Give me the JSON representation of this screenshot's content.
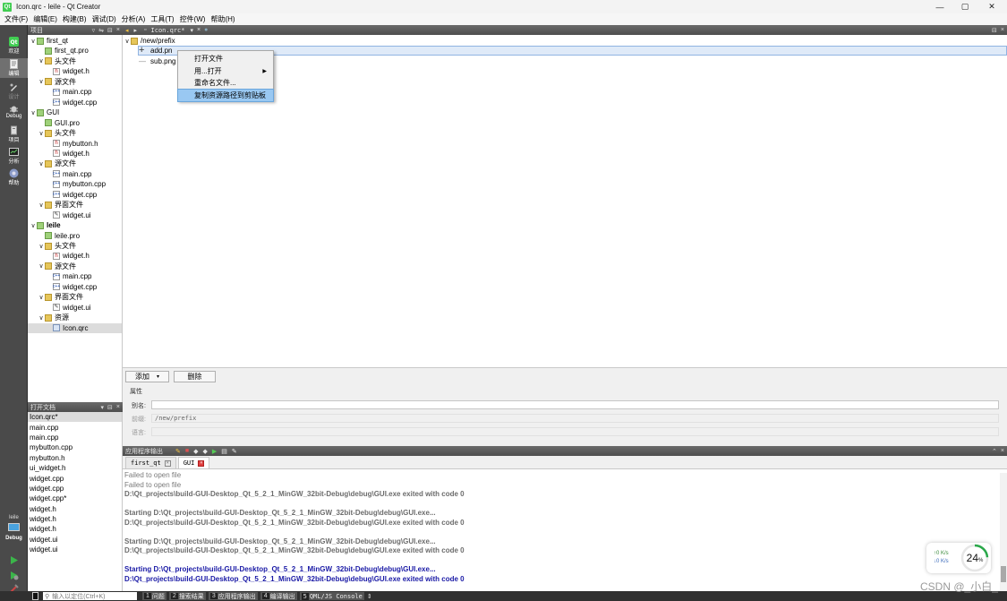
{
  "window": {
    "title": "Icon.qrc - leile - Qt Creator",
    "app_icon_text": "Qt",
    "minimize": "—",
    "maximize": "▢",
    "close": "✕"
  },
  "menubar": [
    "文件(F)",
    "编辑(E)",
    "构建(B)",
    "调试(D)",
    "分析(A)",
    "工具(T)",
    "控件(W)",
    "帮助(H)"
  ],
  "modes": [
    {
      "label": "欢迎",
      "icon": "welcome-icon"
    },
    {
      "label": "编辑",
      "icon": "edit-icon",
      "active": true
    },
    {
      "label": "设计",
      "icon": "design-icon"
    },
    {
      "label": "Debug",
      "icon": "debug-icon"
    },
    {
      "label": "项目",
      "icon": "projects-icon"
    },
    {
      "label": "分析",
      "icon": "analyze-icon"
    },
    {
      "label": "帮助",
      "icon": "help-icon"
    }
  ],
  "kit": {
    "project": "leile",
    "mode": "Debug"
  },
  "project_pane": {
    "title": "项目"
  },
  "project_tree": [
    {
      "indent": 0,
      "arrow": "∨",
      "icon": "pro",
      "label": "first_qt"
    },
    {
      "indent": 1,
      "arrow": "",
      "icon": "pro-file",
      "label": "first_qt.pro"
    },
    {
      "indent": 1,
      "arrow": "∨",
      "icon": "folder",
      "label": "头文件"
    },
    {
      "indent": 2,
      "arrow": "",
      "icon": "h",
      "label": "widget.h"
    },
    {
      "indent": 1,
      "arrow": "∨",
      "icon": "folder",
      "label": "源文件"
    },
    {
      "indent": 2,
      "arrow": "",
      "icon": "cpp",
      "label": "main.cpp"
    },
    {
      "indent": 2,
      "arrow": "",
      "icon": "cpp",
      "label": "widget.cpp"
    },
    {
      "indent": 0,
      "arrow": "∨",
      "icon": "pro",
      "label": "GUI"
    },
    {
      "indent": 1,
      "arrow": "",
      "icon": "pro-file",
      "label": "GUI.pro"
    },
    {
      "indent": 1,
      "arrow": "∨",
      "icon": "folder",
      "label": "头文件"
    },
    {
      "indent": 2,
      "arrow": "",
      "icon": "h",
      "label": "mybutton.h"
    },
    {
      "indent": 2,
      "arrow": "",
      "icon": "h",
      "label": "widget.h"
    },
    {
      "indent": 1,
      "arrow": "∨",
      "icon": "folder",
      "label": "源文件"
    },
    {
      "indent": 2,
      "arrow": "",
      "icon": "cpp",
      "label": "main.cpp"
    },
    {
      "indent": 2,
      "arrow": "",
      "icon": "cpp",
      "label": "mybutton.cpp"
    },
    {
      "indent": 2,
      "arrow": "",
      "icon": "cpp",
      "label": "widget.cpp"
    },
    {
      "indent": 1,
      "arrow": "∨",
      "icon": "folder",
      "label": "界面文件"
    },
    {
      "indent": 2,
      "arrow": "",
      "icon": "ui",
      "label": "widget.ui"
    },
    {
      "indent": 0,
      "arrow": "∨",
      "icon": "pro",
      "label": "leile",
      "bold": true
    },
    {
      "indent": 1,
      "arrow": "",
      "icon": "pro-file",
      "label": "leile.pro"
    },
    {
      "indent": 1,
      "arrow": "∨",
      "icon": "folder",
      "label": "头文件"
    },
    {
      "indent": 2,
      "arrow": "",
      "icon": "h",
      "label": "widget.h"
    },
    {
      "indent": 1,
      "arrow": "∨",
      "icon": "folder",
      "label": "源文件"
    },
    {
      "indent": 2,
      "arrow": "",
      "icon": "cpp",
      "label": "main.cpp"
    },
    {
      "indent": 2,
      "arrow": "",
      "icon": "cpp",
      "label": "widget.cpp"
    },
    {
      "indent": 1,
      "arrow": "∨",
      "icon": "folder",
      "label": "界面文件"
    },
    {
      "indent": 2,
      "arrow": "",
      "icon": "ui",
      "label": "widget.ui"
    },
    {
      "indent": 1,
      "arrow": "∨",
      "icon": "folder",
      "label": "资源"
    },
    {
      "indent": 2,
      "arrow": "",
      "icon": "qrc",
      "label": "Icon.qrc",
      "selected": true
    }
  ],
  "open_docs": {
    "title": "打开文档",
    "items": [
      {
        "label": "Icon.qrc*",
        "selected": true
      },
      {
        "label": "main.cpp"
      },
      {
        "label": "main.cpp"
      },
      {
        "label": "mybutton.cpp"
      },
      {
        "label": "mybutton.h"
      },
      {
        "label": "ui_widget.h"
      },
      {
        "label": "widget.cpp"
      },
      {
        "label": "widget.cpp"
      },
      {
        "label": "widget.cpp*"
      },
      {
        "label": "widget.h"
      },
      {
        "label": "widget.h"
      },
      {
        "label": "widget.h"
      },
      {
        "label": "widget.ui"
      },
      {
        "label": "widget.ui"
      }
    ]
  },
  "editor": {
    "tab_label": "Icon.qrc*",
    "prefix": "/new/prefix",
    "files": [
      {
        "label": "add.pn",
        "selected": true
      },
      {
        "label": "sub.png"
      }
    ]
  },
  "context_menu": [
    {
      "label": "打开文件"
    },
    {
      "label": "用...打开",
      "submenu": true
    },
    {
      "label": "重命名文件..."
    },
    {
      "label": "复制资源路径到剪贴板",
      "highlighted": true
    }
  ],
  "props": {
    "add_label": "添加",
    "remove_label": "删除",
    "section_title": "属性",
    "alias_label": "别名:",
    "alias_value": "",
    "prefix_label": "前缀:",
    "prefix_value": "/new/prefix",
    "lang_label": "语言:",
    "lang_value": ""
  },
  "output": {
    "title": "应用程序输出",
    "tabs": [
      {
        "label": "first_qt"
      },
      {
        "label": "GUI",
        "active": true
      }
    ],
    "lines": [
      {
        "text": "Failed to open file",
        "style": "gray"
      },
      {
        "text": "Failed to open file",
        "style": "gray"
      },
      {
        "text": "D:\\Qt_projects\\build-GUI-Desktop_Qt_5_2_1_MinGW_32bit-Debug\\debug\\GUI.exe exited with code 0",
        "style": "dim-bold"
      },
      {
        "text": "",
        "style": "gray"
      },
      {
        "text": "Starting D:\\Qt_projects\\build-GUI-Desktop_Qt_5_2_1_MinGW_32bit-Debug\\debug\\GUI.exe...",
        "style": "dim-bold"
      },
      {
        "text": "D:\\Qt_projects\\build-GUI-Desktop_Qt_5_2_1_MinGW_32bit-Debug\\debug\\GUI.exe exited with code 0",
        "style": "dim-bold"
      },
      {
        "text": "",
        "style": "gray"
      },
      {
        "text": "Starting D:\\Qt_projects\\build-GUI-Desktop_Qt_5_2_1_MinGW_32bit-Debug\\debug\\GUI.exe...",
        "style": "dim-bold"
      },
      {
        "text": "D:\\Qt_projects\\build-GUI-Desktop_Qt_5_2_1_MinGW_32bit-Debug\\debug\\GUI.exe exited with code 0",
        "style": "dim-bold"
      },
      {
        "text": "",
        "style": "gray"
      },
      {
        "text": "Starting D:\\Qt_projects\\build-GUI-Desktop_Qt_5_2_1_MinGW_32bit-Debug\\debug\\GUI.exe...",
        "style": "blue-bold"
      },
      {
        "text": "D:\\Qt_projects\\build-GUI-Desktop_Qt_5_2_1_MinGW_32bit-Debug\\debug\\GUI.exe exited with code 0",
        "style": "blue-bold"
      }
    ]
  },
  "statusbar": {
    "locator_placeholder": "输入以定位(Ctrl+K)",
    "tabs": [
      {
        "num": "1",
        "label": "问题"
      },
      {
        "num": "2",
        "label": "搜索结果"
      },
      {
        "num": "3",
        "label": "应用程序输出"
      },
      {
        "num": "4",
        "label": "编译输出"
      },
      {
        "num": "5",
        "label": "QML/JS Console"
      }
    ]
  },
  "network": {
    "up": "0 K/s",
    "down": "0 K/s",
    "cpu": "24",
    "cpu_unit": "%",
    "cpu_fraction": 0.24
  },
  "watermark": "CSDN @_小白_",
  "colors": {
    "accent": "#41cd52",
    "selection": "#99c8f2",
    "output_blue": "#1a1aa6",
    "output_dim": "#6c6c6c"
  }
}
